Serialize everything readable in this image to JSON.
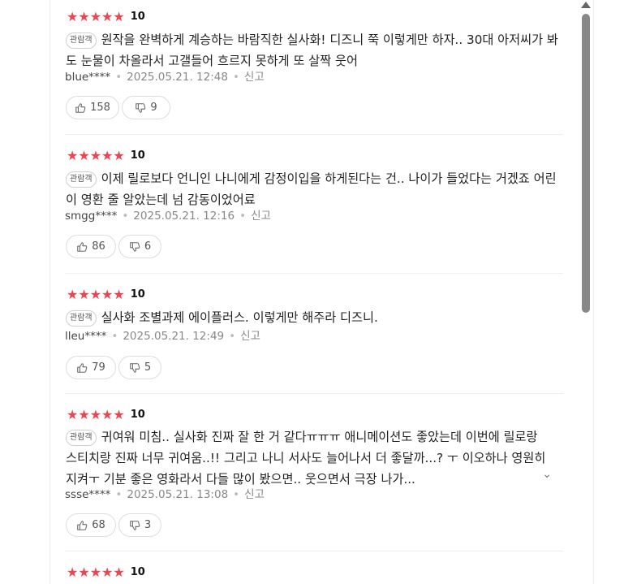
{
  "reviews": [
    {
      "stars": "★★★★★",
      "score": "10",
      "badge": "관람객",
      "text": "원작을 완벽하게 계승하는 바람직한 실사화! 디즈니 쭉 이렇게만 하자.. 30대 아저씨가 봐도 눈물이 차올라서 고갤들어 흐르지 못하게 또 살짝 웃어",
      "user": "blue****",
      "date": "2025.05.21. 12:48",
      "report": "신고",
      "likes": "158",
      "dislikes": "9",
      "expandable": false
    },
    {
      "stars": "★★★★★",
      "score": "10",
      "badge": "관람객",
      "text": "이제 릴로보다 언니인 나니에게 감정이입을 하게된다는 건.. 나이가 들었다는 거겠죠 어린이 영환 줄 알았는데 넘 감동이었어료",
      "user": "smgg****",
      "date": "2025.05.21. 12:16",
      "report": "신고",
      "likes": "86",
      "dislikes": "6",
      "expandable": false
    },
    {
      "stars": "★★★★★",
      "score": "10",
      "badge": "관람객",
      "text": "실사화 조별과제 에이플러스. 이렇게만 해주라 디즈니.",
      "user": "lleu****",
      "date": "2025.05.21. 12:49",
      "report": "신고",
      "likes": "79",
      "dislikes": "5",
      "expandable": false
    },
    {
      "stars": "★★★★★",
      "score": "10",
      "badge": "관람객",
      "text": "귀여워 미침.. 실사화 진짜 잘 한 거 같다ㅠㅠㅠ 애니메이션도 좋았는데 이번에 릴로랑 스티치랑 진짜 너무 귀여움..!! 그리고 나니 서사도 늘어나서 더 좋달까...? ㅜ 이오하나 영원히 지켜ㅜ 기분 좋은 영화라서 다들 많이 봤으면.. 웃으면서 극장 나가...",
      "user": "ssse****",
      "date": "2025.05.21. 13:08",
      "report": "신고",
      "likes": "68",
      "dislikes": "3",
      "expandable": true
    },
    {
      "stars": "★★★★★",
      "score": "10"
    }
  ],
  "icons": {
    "like": "thumbs-up-icon",
    "dislike": "thumbs-down-icon",
    "expand": "chevron-down-icon"
  },
  "colors": {
    "star": "#f0434f",
    "scrollbar_thumb": "#878787"
  }
}
